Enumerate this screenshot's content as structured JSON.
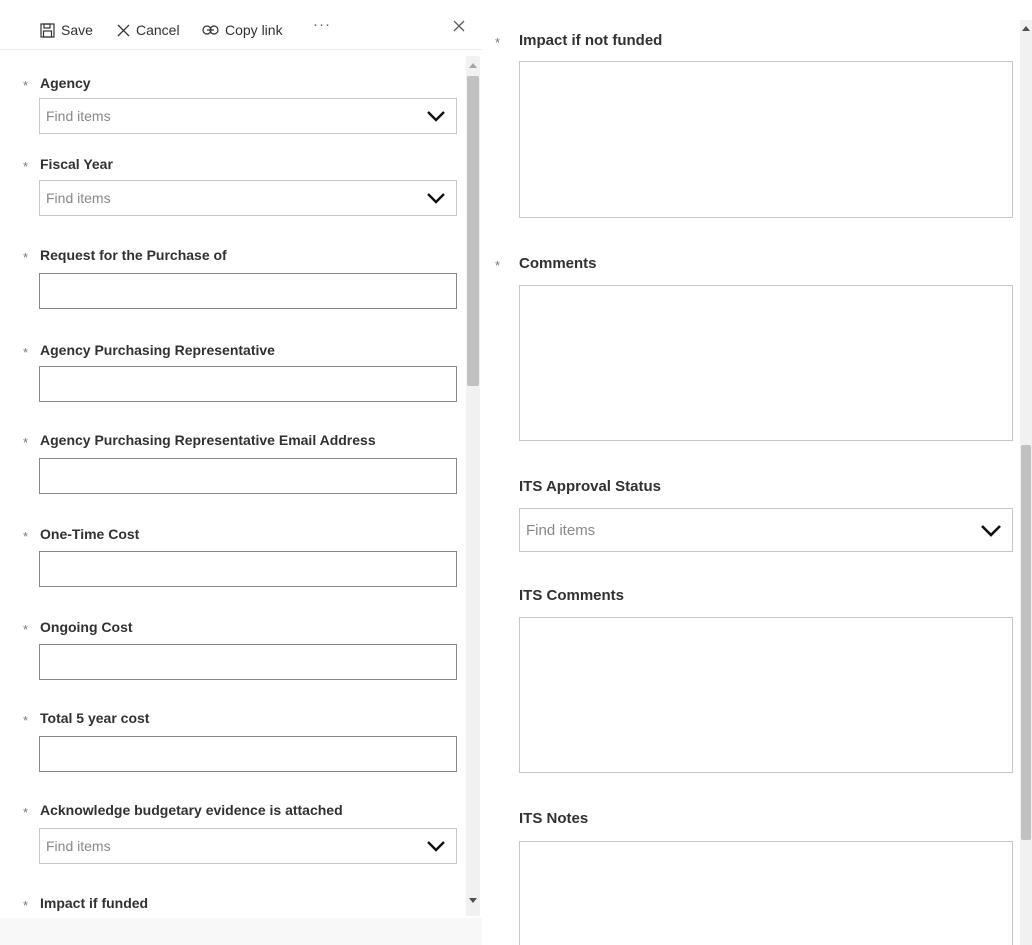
{
  "toolbar": {
    "save_label": "Save",
    "cancel_label": "Cancel",
    "copy_link_label": "Copy link",
    "more_label": "···"
  },
  "required_marker": "*",
  "left_form": {
    "agency_label": "Agency",
    "agency_placeholder": "Find items",
    "fiscal_year_label": "Fiscal Year",
    "fiscal_year_placeholder": "Find items",
    "request_label": "Request for the Purchase of",
    "rep_label": "Agency Purchasing Representative",
    "rep_email_label": "Agency Purchasing Representative Email Address",
    "one_time_label": "One-Time Cost",
    "ongoing_label": "Ongoing Cost",
    "total5_label": "Total 5 year cost",
    "ack_label": "Acknowledge budgetary evidence is attached",
    "ack_placeholder": "Find items",
    "impact_funded_label": "Impact if funded"
  },
  "right_form": {
    "impact_not_funded_label": "Impact if not funded",
    "comments_label": "Comments",
    "its_status_label": "ITS Approval Status",
    "its_status_placeholder": "Find items",
    "its_comments_label": "ITS Comments",
    "its_notes_label": "ITS Notes"
  },
  "colors": {
    "text": "#323130",
    "placeholder": "#8a8886",
    "border": "#8a8886",
    "scroll_thumb": "#c1c1c1"
  },
  "icons": {
    "save": "floppy-disk",
    "cancel": "x",
    "copy_link": "chain-link",
    "close": "x",
    "dropdown": "chevron-down"
  }
}
